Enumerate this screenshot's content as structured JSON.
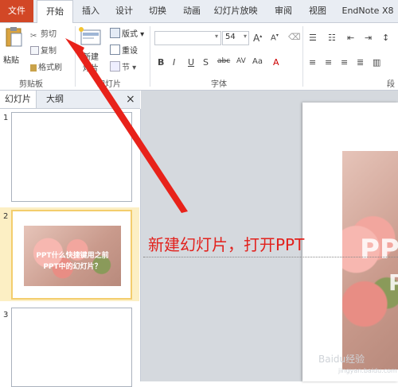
{
  "tabs": {
    "file": "文件",
    "home": "开始",
    "insert": "插入",
    "design": "设计",
    "transitions": "切换",
    "animations": "动画",
    "slideshow": "幻灯片放映",
    "review": "审阅",
    "view": "视图",
    "endnote": "EndNote X8"
  },
  "ribbon": {
    "paste": "粘贴",
    "cut": "剪切",
    "copy": "复制",
    "format_painter": "格式刷",
    "clipboard_group": "剪贴板",
    "new_slide_line1": "新建",
    "new_slide_line2": "灯片",
    "layout": "版式",
    "reset": "重设",
    "section": "节",
    "slides_group": "幻灯片",
    "font_size": "54",
    "font_group": "字体",
    "paragraph_group": "段"
  },
  "pane": {
    "tab_slides": "幻灯片",
    "tab_outline": "大纲",
    "close": "×",
    "slide_numbers": [
      "1",
      "2",
      "3"
    ],
    "thumb2_line1": "PPT什么快捷键用之前",
    "thumb2_line2": "PPT中的幻灯片？"
  },
  "main": {
    "ppt_big": "PPT",
    "ppt_small": "P"
  },
  "annotation": "新建幻灯片，打开PPT",
  "watermark": "Baidu经验",
  "watermark_sub": "jingyan.baidu.com",
  "colors": {
    "file_tab": "#d24726",
    "arrow": "#e8221a",
    "selected_thumb": "#f3cd6d"
  }
}
